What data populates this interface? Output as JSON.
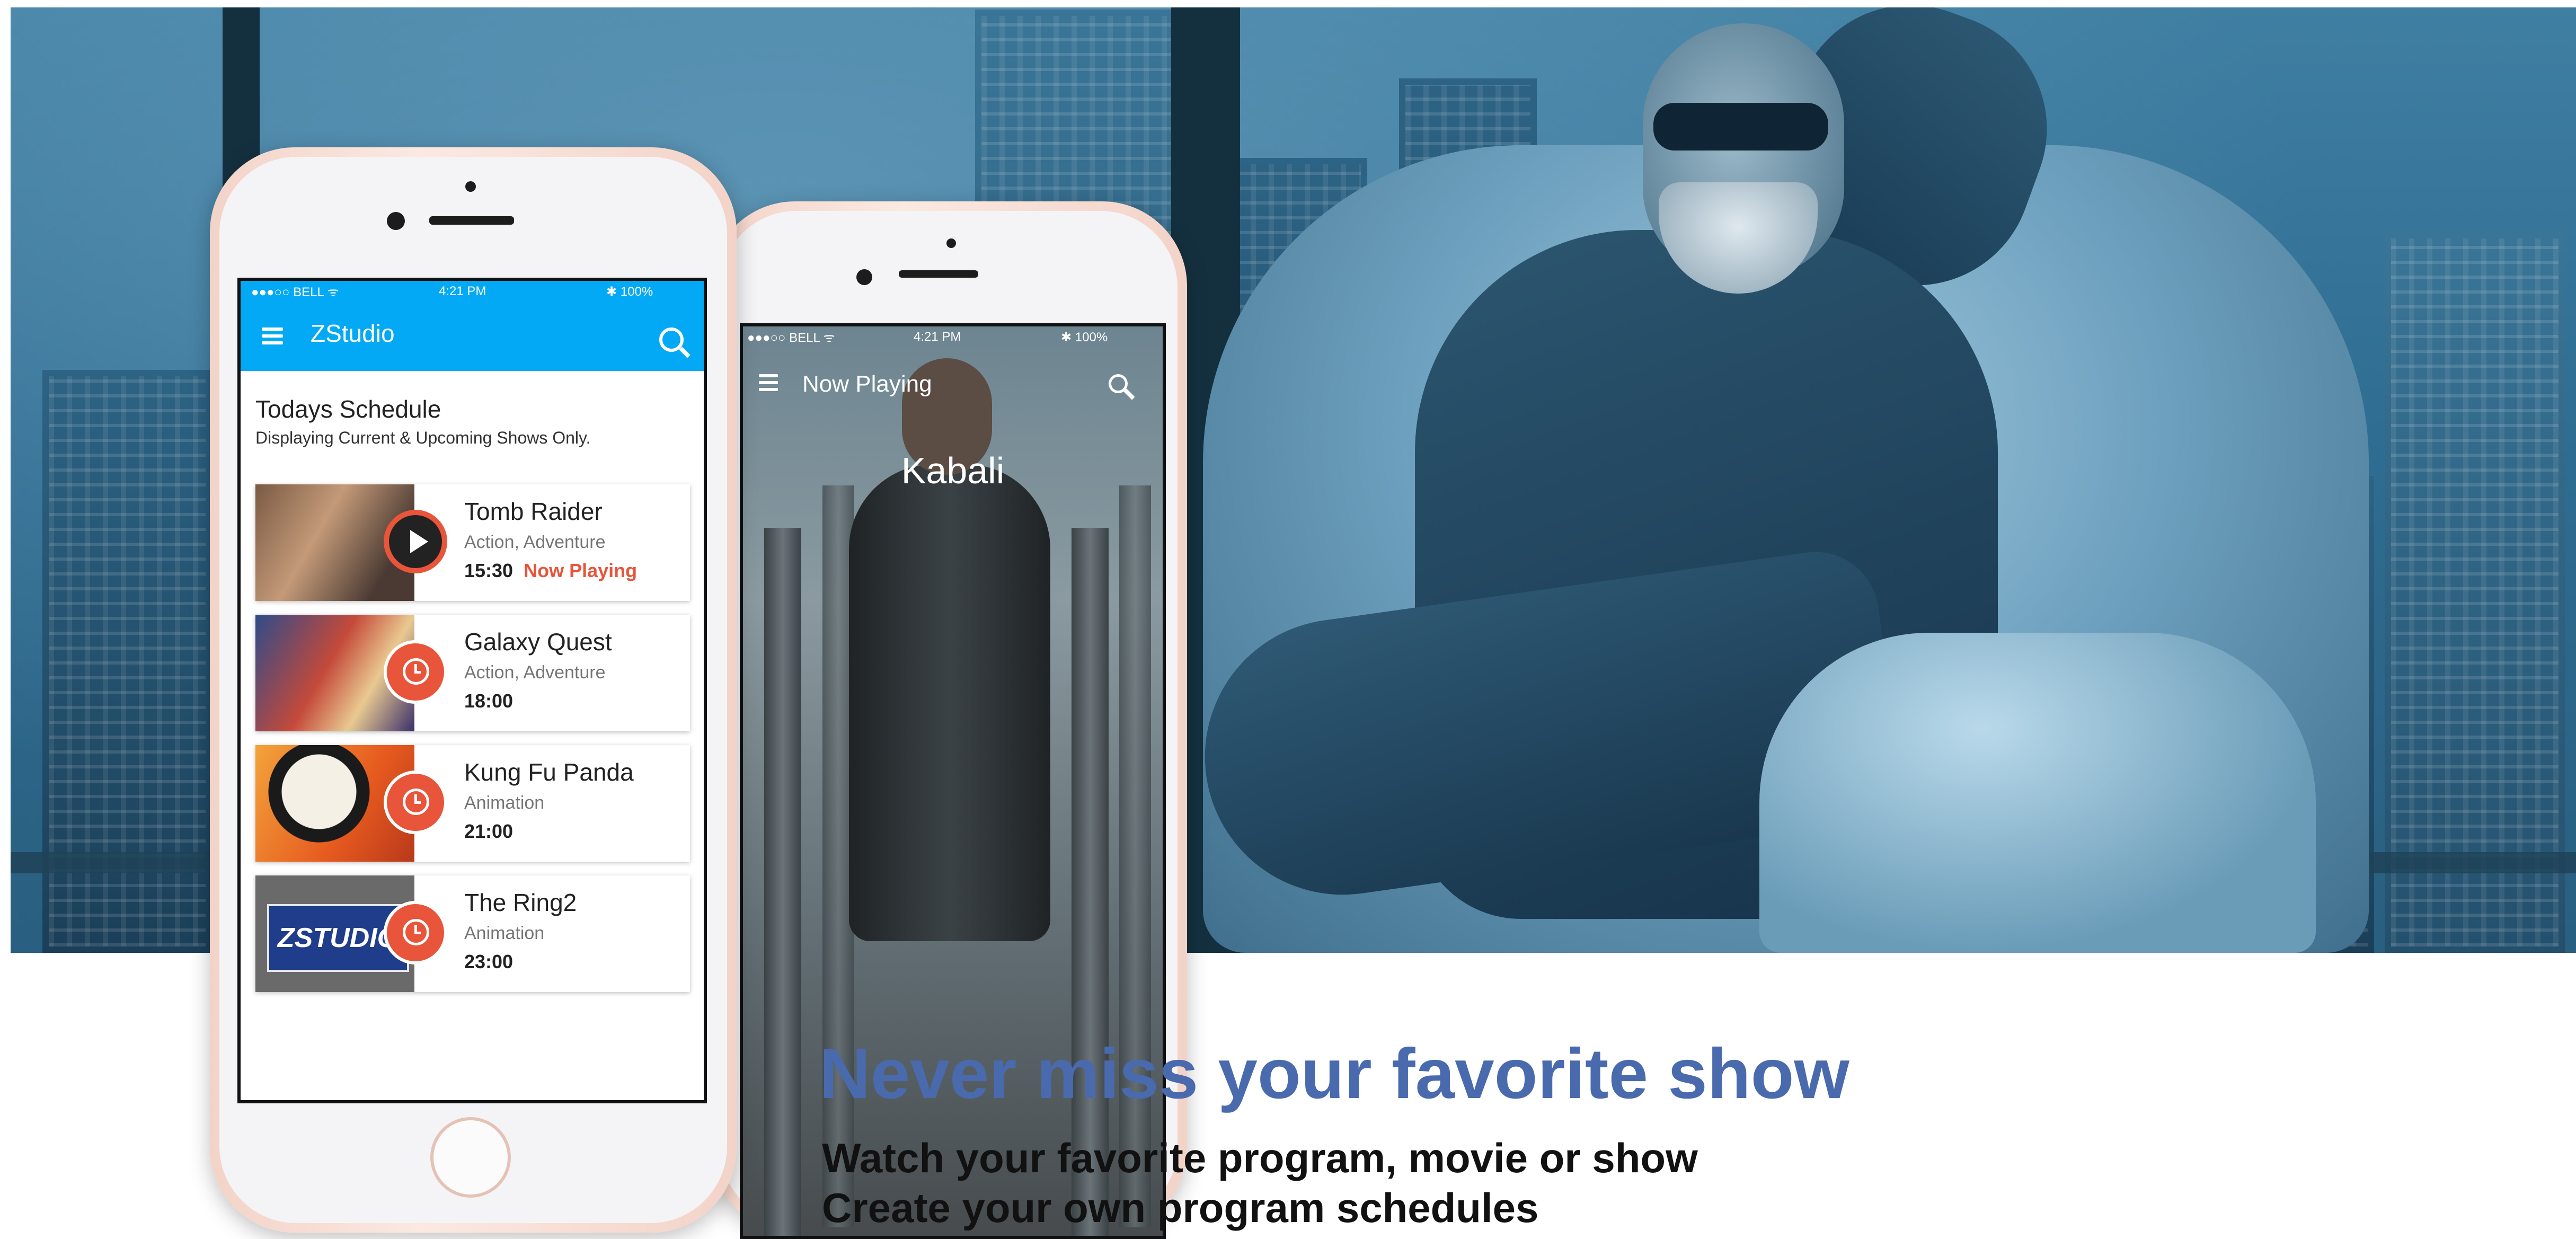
{
  "phone1": {
    "status": {
      "carrier": "●●●○○ BELL ᯤ",
      "time": "4:21 PM",
      "battery": "✱ 100%"
    },
    "appbar": {
      "title": "ZStudio"
    },
    "schedule": {
      "title": "Todays Schedule",
      "subtitle": "Displaying Current & Upcoming Shows Only."
    },
    "shows": [
      {
        "title": "Tomb Raider",
        "genre": "Action, Adventure",
        "time": "15:30",
        "status": "Now Playing",
        "badge": "play-icon"
      },
      {
        "title": "Galaxy Quest",
        "genre": "Action, Adventure",
        "time": "18:00",
        "badge": "alarm-icon"
      },
      {
        "title": "Kung Fu Panda",
        "genre": "Animation",
        "time": "21:00",
        "badge": "alarm-icon"
      },
      {
        "title": "The Ring2",
        "genre": "Animation",
        "time": "23:00",
        "badge": "alarm-icon"
      }
    ],
    "thumb4_text": "ZSTUDIO"
  },
  "phone2": {
    "status": {
      "carrier": "●●●○○ BELL ᯤ",
      "time": "4:21 PM",
      "battery": "✱ 100%"
    },
    "appbar": {
      "title": "Now Playing"
    },
    "movie_title": "Kabali"
  },
  "marketing": {
    "headline": "Never miss your favorite show",
    "line1": "Watch your favorite program, movie or show",
    "line2": "Create your own program schedules"
  },
  "colors": {
    "accent": "#03a9f4",
    "highlight": "#e8553a",
    "headline": "#4a6aae"
  }
}
